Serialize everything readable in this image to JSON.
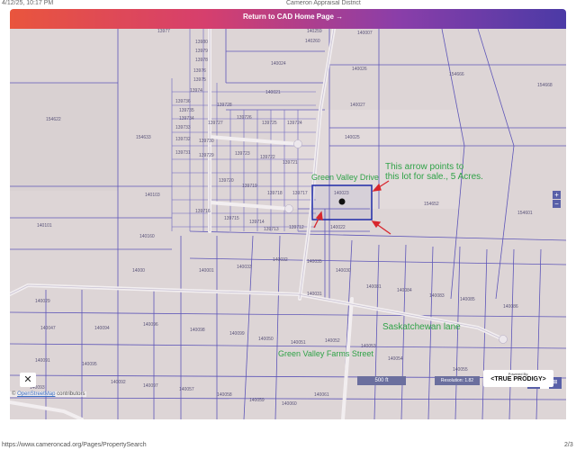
{
  "print_header": {
    "date": "4/12/25, 10:17 PM",
    "title": "Cameron Appraisal District"
  },
  "topbar": {
    "return_label": "Return to CAD Home Page →"
  },
  "annotations": {
    "arrow_note": "This arrow points to\nthis lot for sale., 5 Acres.",
    "green_valley_drive": "Green Valley Drive",
    "saskatchewan_lane": "Saskatchewan lane",
    "green_valley_farms_street": "Green Valley Farms Street"
  },
  "map_labels": [
    "13980",
    "13979",
    "13978",
    "13977",
    "13976",
    "13975",
    "13974",
    "13973",
    "13972",
    "13971",
    "13970",
    "139736",
    "139735",
    "139734",
    "139733",
    "139732",
    "139731",
    "139730",
    "139729",
    "139728",
    "139727",
    "139726",
    "139725",
    "139724",
    "139723",
    "139722",
    "139721",
    "139720",
    "139719",
    "139718",
    "139717",
    "139716",
    "139715",
    "139714",
    "139713",
    "139712",
    "139711",
    "139710",
    "140259",
    "140260",
    "140007",
    "140024",
    "140021",
    "140027",
    "140026",
    "140025",
    "140023",
    "140022",
    "154666",
    "154668",
    "154622",
    "154633",
    "154652",
    "154601",
    "140127",
    "154618",
    "140101",
    "140103",
    "140160",
    "14000",
    "140001",
    "140014",
    "140033",
    "140032",
    "140035",
    "140030",
    "140031",
    "140029",
    "140081",
    "140084",
    "140083",
    "140085",
    "140086",
    "140040",
    "140041",
    "140043",
    "140044",
    "140046",
    "140045",
    "140047",
    "140091",
    "140092",
    "140093",
    "140094",
    "140095",
    "140096",
    "140097",
    "140098",
    "140099",
    "140050",
    "140051",
    "140052",
    "140053",
    "140054",
    "140055",
    "140056",
    "140057",
    "140058",
    "140059",
    "140060",
    "140061",
    "140062",
    "140063",
    "140064",
    "140065",
    "140066",
    "140067"
  ],
  "map_controls": {
    "zoom_in": "+",
    "zoom_out": "−",
    "tools_icon": "✕",
    "scale": "500 ft",
    "resolution": "Resolution: 1.82",
    "layer_count": "11"
  },
  "attribution": {
    "prefix": "© ",
    "osm": "OpenStreetMap",
    "suffix": " contributors"
  },
  "powered_by": {
    "label": "Powered By:",
    "brand": "<TRUE PRODIGY>"
  },
  "footer": {
    "url": "https://www.cameroncad.org/Pages/PropertySearch",
    "page": "2/3"
  },
  "colors": {
    "accent_left": "#e9553d",
    "accent_right": "#4b3aa6",
    "parcel_line": "#5e56b8",
    "highlight": "#1f2ba8",
    "annotation_arrow": "#d8262d",
    "annotation_text": "#2fa247"
  }
}
